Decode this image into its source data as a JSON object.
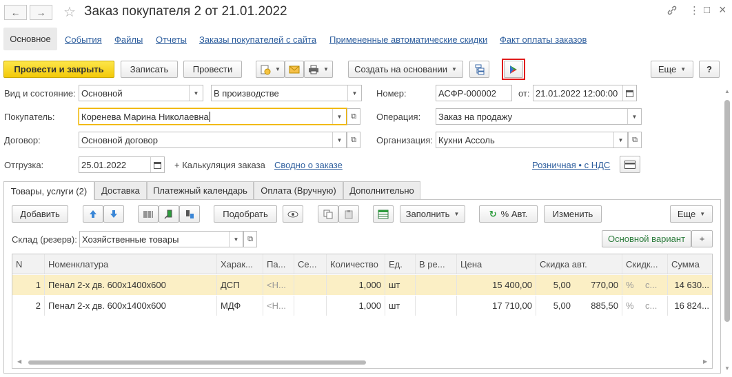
{
  "window": {
    "title": "Заказ покупателя 2 от 21.01.2022",
    "back_icon": "←",
    "forward_icon": "→",
    "star_icon": "☆",
    "link_icon": "🔗",
    "more_icon": "⋮",
    "minimize_icon": "□",
    "close_icon": "×"
  },
  "sections": {
    "active": "Основное",
    "links": [
      "События",
      "Файлы",
      "Отчеты",
      "Заказы покупателей с сайта",
      "Примененные автоматические скидки",
      "Факт оплаты заказов"
    ]
  },
  "toolbar": {
    "post_close": "Провести и закрыть",
    "save": "Записать",
    "post": "Провести",
    "create_based": "Создать на основании",
    "more": "Еще",
    "help": "?"
  },
  "form": {
    "kind_label": "Вид и состояние:",
    "kind_value": "Основной",
    "state_value": "В производстве",
    "number_label": "Номер:",
    "number_value": "АСФР-000002",
    "from_label": "от:",
    "date_value": "21.01.2022 12:00:00",
    "buyer_label": "Покупатель:",
    "buyer_value": "Коренева Марина Николаевна",
    "operation_label": "Операция:",
    "operation_value": "Заказ на продажу",
    "contract_label": "Договор:",
    "contract_value": "Основной договор",
    "org_label": "Организация:",
    "org_value": "Кухни Ассоль",
    "shipment_label": "Отгрузка:",
    "shipment_value": "25.01.2022",
    "calc_label": "+ Калькуляция заказа",
    "summary_link": "Сводно о заказе",
    "price_link": "Розничная • с НДС"
  },
  "tabs": [
    "Товары, услуги (2)",
    "Доставка",
    "Платежный календарь",
    "Оплата (Вручную)",
    "Дополнительно"
  ],
  "table_toolbar": {
    "add": "Добавить",
    "pick": "Подобрать",
    "fill": "Заполнить",
    "auto_pct": "% Авт.",
    "change": "Изменить",
    "more": "Еще"
  },
  "warehouse": {
    "label": "Склад (резерв):",
    "value": "Хозяйственные товары",
    "variant": "Основной вариант",
    "plus": "+"
  },
  "table": {
    "columns": [
      "N",
      "Номенклатура",
      "Харак...",
      "Па...",
      "Се...",
      "Количество",
      "Ед.",
      "В ре...",
      "Цена",
      "Скидка авт.",
      "Скидк...",
      "Сумма"
    ],
    "rows": [
      [
        "1",
        "Пенал 2-х дв. 600х1400х600",
        "ДСП",
        "<Н...",
        "",
        "1,000",
        "шт",
        "",
        "15 400,00",
        "5,00",
        "770,00",
        "%",
        "с...",
        "14 630..."
      ],
      [
        "2",
        "Пенал 2-х дв. 600х1400х600",
        "МДФ",
        "<Н...",
        "",
        "1,000",
        "шт",
        "",
        "17 710,00",
        "5,00",
        "885,50",
        "%",
        "с...",
        "16 824..."
      ]
    ]
  }
}
